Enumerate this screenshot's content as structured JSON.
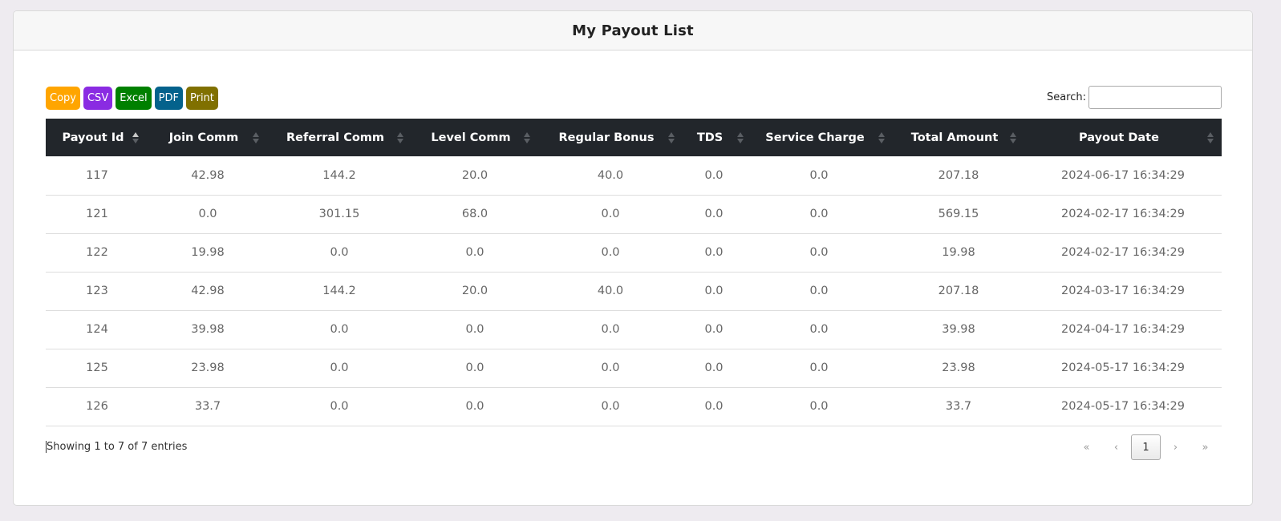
{
  "page": {
    "title": "My Payout List"
  },
  "buttons": [
    {
      "label": "Copy",
      "color": "#ffa500"
    },
    {
      "label": "CSV",
      "color": "#8a2be2"
    },
    {
      "label": "Excel",
      "color": "#008000"
    },
    {
      "label": "PDF",
      "color": "#04628c"
    },
    {
      "label": "Print",
      "color": "#807000"
    }
  ],
  "search": {
    "label": "Search:",
    "value": "",
    "placeholder": ""
  },
  "table": {
    "columns": [
      "Payout Id",
      "Join Comm",
      "Referral Comm",
      "Level Comm",
      "Regular Bonus",
      "TDS",
      "Service Charge",
      "Total Amount",
      "Payout Date"
    ],
    "sorted_column": "Payout Id",
    "rows": [
      [
        "117",
        "42.98",
        "144.2",
        "20.0",
        "40.0",
        "0.0",
        "0.0",
        "207.18",
        "2024-06-17 16:34:29"
      ],
      [
        "121",
        "0.0",
        "301.15",
        "68.0",
        "0.0",
        "0.0",
        "0.0",
        "569.15",
        "2024-02-17 16:34:29"
      ],
      [
        "122",
        "19.98",
        "0.0",
        "0.0",
        "0.0",
        "0.0",
        "0.0",
        "19.98",
        "2024-02-17 16:34:29"
      ],
      [
        "123",
        "42.98",
        "144.2",
        "20.0",
        "40.0",
        "0.0",
        "0.0",
        "207.18",
        "2024-03-17 16:34:29"
      ],
      [
        "124",
        "39.98",
        "0.0",
        "0.0",
        "0.0",
        "0.0",
        "0.0",
        "39.98",
        "2024-04-17 16:34:29"
      ],
      [
        "125",
        "23.98",
        "0.0",
        "0.0",
        "0.0",
        "0.0",
        "0.0",
        "23.98",
        "2024-05-17 16:34:29"
      ],
      [
        "126",
        "33.7",
        "0.0",
        "0.0",
        "0.0",
        "0.0",
        "0.0",
        "33.7",
        "2024-05-17 16:34:29"
      ]
    ]
  },
  "footer": {
    "info": "Showing 1 to 7 of 7 entries",
    "pagination": {
      "first": "«",
      "prev": "‹",
      "current": "1",
      "next": "›",
      "last": "»"
    }
  }
}
